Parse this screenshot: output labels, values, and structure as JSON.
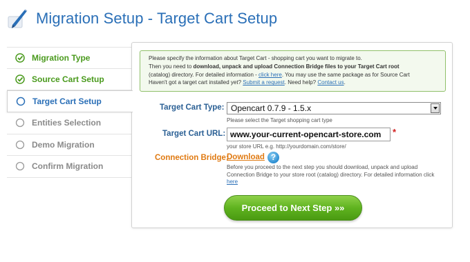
{
  "header": {
    "title": "Migration Setup - Target Cart Setup"
  },
  "steps": [
    {
      "label": "Migration Type",
      "state": "done"
    },
    {
      "label": "Source Cart Setup",
      "state": "done"
    },
    {
      "label": "Target Cart Setup",
      "state": "active"
    },
    {
      "label": "Entities Selection",
      "state": "todo"
    },
    {
      "label": "Demo Migration",
      "state": "todo"
    },
    {
      "label": "Confirm Migration",
      "state": "todo"
    }
  ],
  "info": {
    "line1": "Please specify the information about Target Cart - shopping cart you want to migrate to.",
    "line2_pre": "Then you need to ",
    "line2_bold": "download, unpack and upload Connection Bridge files to your Target Cart root",
    "line3_pre": "(catalog) directory. For detailed information - ",
    "line3_link": "click here",
    "line3_post": ". You may use the same package as for Source Cart",
    "line4_pre": "Haven't got a target cart installed yet? ",
    "line4_link1": "Submit a request",
    "line4_mid": ". Need help? ",
    "line4_link2": "Contact us",
    "line4_post": "."
  },
  "form": {
    "cart_type_label": "Target Cart Type:",
    "cart_type_value": "Opencart 0.7.9 - 1.5.x",
    "cart_type_hint": "Please select the Target shopping cart type",
    "url_label": "Target Cart URL:",
    "url_value": "www.your-current-opencart-store.com",
    "url_required": "*",
    "url_hint": "your store URL e.g. http://yourdomain.com/store/",
    "bridge_label": "Connection Bridge:",
    "bridge_link": "Download",
    "help_glyph": "?",
    "bridge_hint1": "Before you proceed to the next step you should download, unpack and upload",
    "bridge_hint2": "Connection Bridge to your store root (catalog) directory. For detailed information click",
    "bridge_hint_link": "here"
  },
  "actions": {
    "next_label": "Proceed to Next Step »»"
  },
  "colors": {
    "accent_blue": "#2a6fb7",
    "done_green": "#4a9a1d",
    "orange": "#e07a12",
    "button_green": "#5fb31f",
    "required_red": "#d21c1c"
  }
}
